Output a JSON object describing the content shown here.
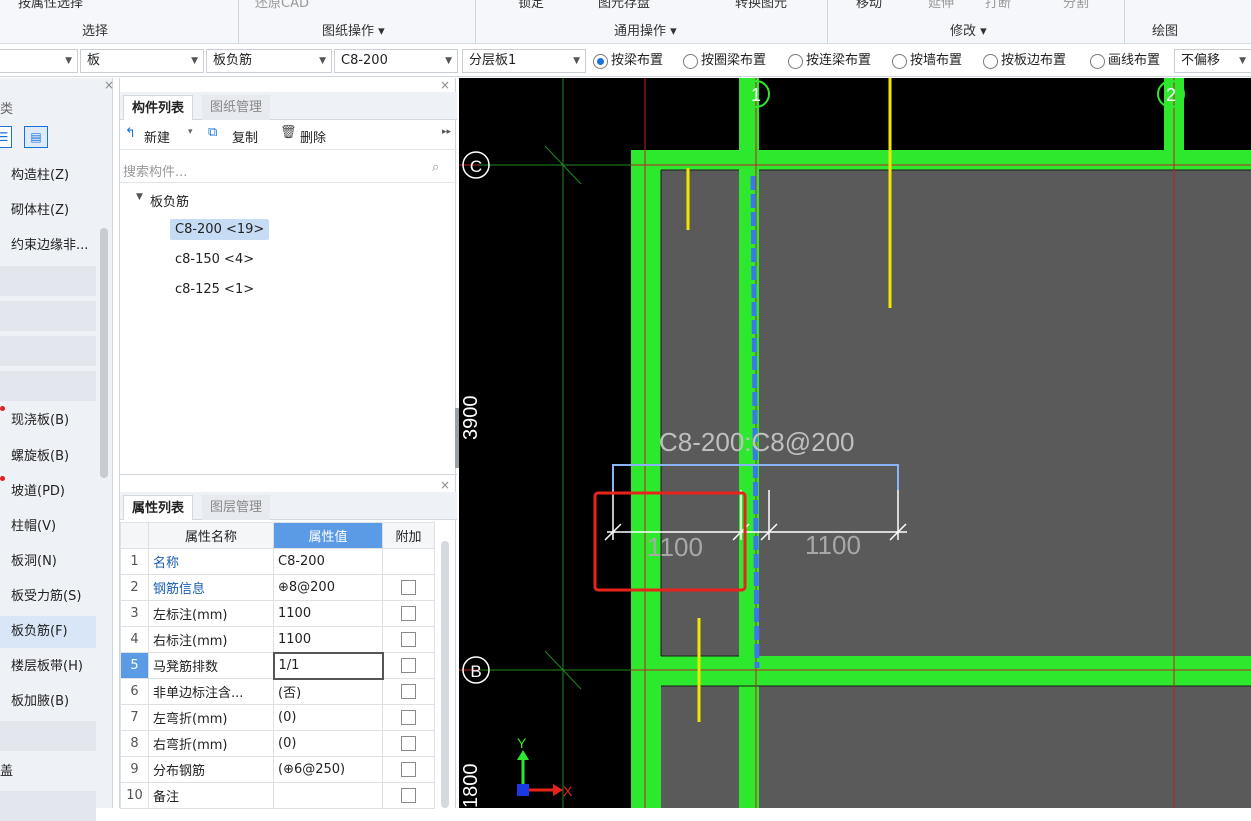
{
  "ribbon": {
    "tools": [
      "按属性选择",
      "还原CAD",
      "锁定",
      "图元存盘",
      "转换图元",
      "移动",
      "延伸",
      "打断",
      "分割"
    ],
    "groups": [
      "选择",
      "图纸操作 ▾",
      "通用操作 ▾",
      "修改 ▾",
      "绘图"
    ]
  },
  "propbar": {
    "combo1": "",
    "combo2": "板",
    "combo3": "板负筋",
    "combo4": "C8-200",
    "combo5": "分层板1",
    "radios": [
      "按梁布置",
      "按圈梁布置",
      "按连梁布置",
      "按墙布置",
      "按板边布置",
      "画线布置"
    ],
    "radio_selected": 0,
    "offset": "不偏移"
  },
  "left_panel": {
    "header_char": "类",
    "items": [
      {
        "label": "构造柱(Z)",
        "dot": false
      },
      {
        "label": "砌体柱(Z)",
        "dot": false
      },
      {
        "label": "约束边缘非...",
        "dot": false
      },
      {
        "label": "现浇板(B)",
        "dot": true
      },
      {
        "label": "螺旋板(B)",
        "dot": false
      },
      {
        "label": "坡道(PD)",
        "dot": true
      },
      {
        "label": "柱帽(V)",
        "dot": false
      },
      {
        "label": "板洞(N)",
        "dot": false
      },
      {
        "label": "板受力筋(S)",
        "dot": false
      },
      {
        "label": "板负筋(F)",
        "dot": false
      },
      {
        "label": "楼层板带(H)",
        "dot": false
      },
      {
        "label": "板加腋(B)",
        "dot": false
      },
      {
        "label": "盖",
        "dot": false
      }
    ]
  },
  "component_list": {
    "tab_active": "构件列表",
    "tab_inactive": "图纸管理",
    "new_label": "新建",
    "copy_label": "复制",
    "delete_label": "删除",
    "search_placeholder": "搜索构件...",
    "tree_root": "板负筋",
    "tree_items": [
      "C8-200 <19>",
      "c8-150 <4>",
      "c8-125 <1>"
    ]
  },
  "property_list": {
    "tab_active": "属性列表",
    "tab_inactive": "图层管理",
    "headers": [
      "属性名称",
      "属性值",
      "附加"
    ],
    "rows": [
      {
        "num": "1",
        "name": "名称",
        "value": "C8-200",
        "blue": true,
        "check": false
      },
      {
        "num": "2",
        "name": "钢筋信息",
        "value": "⊕8@200",
        "blue": true,
        "check": true
      },
      {
        "num": "3",
        "name": "左标注(mm)",
        "value": "1100",
        "blue": false,
        "check": true
      },
      {
        "num": "4",
        "name": "右标注(mm)",
        "value": "1100",
        "blue": false,
        "check": true
      },
      {
        "num": "5",
        "name": "马凳筋排数",
        "value": "1/1",
        "blue": false,
        "check": true
      },
      {
        "num": "6",
        "name": "非单边标注含...",
        "value": "(否)",
        "blue": false,
        "check": true
      },
      {
        "num": "7",
        "name": "左弯折(mm)",
        "value": "(0)",
        "blue": false,
        "check": true
      },
      {
        "num": "8",
        "name": "右弯折(mm)",
        "value": "(0)",
        "blue": false,
        "check": true
      },
      {
        "num": "9",
        "name": "分布钢筋",
        "value": "(⊕6@250)",
        "blue": false,
        "check": true
      },
      {
        "num": "10",
        "name": "备注",
        "value": "",
        "blue": false,
        "check": true
      }
    ]
  },
  "canvas": {
    "axis_1": "1",
    "axis_2": "2",
    "axis_c": "C",
    "axis_b": "B",
    "dim_vertical": "3900",
    "dim_vertical_2": "1800",
    "rebar_label": "C8-200:C8@200",
    "left_dim": "1100",
    "right_dim": "1100",
    "ucs_y": "Y",
    "ucs_x": "X",
    "colors": {
      "green": "#2ee82e",
      "slab": "#5a5a5a",
      "grid": "#c02020",
      "rebar": "#8ab4f8"
    }
  }
}
